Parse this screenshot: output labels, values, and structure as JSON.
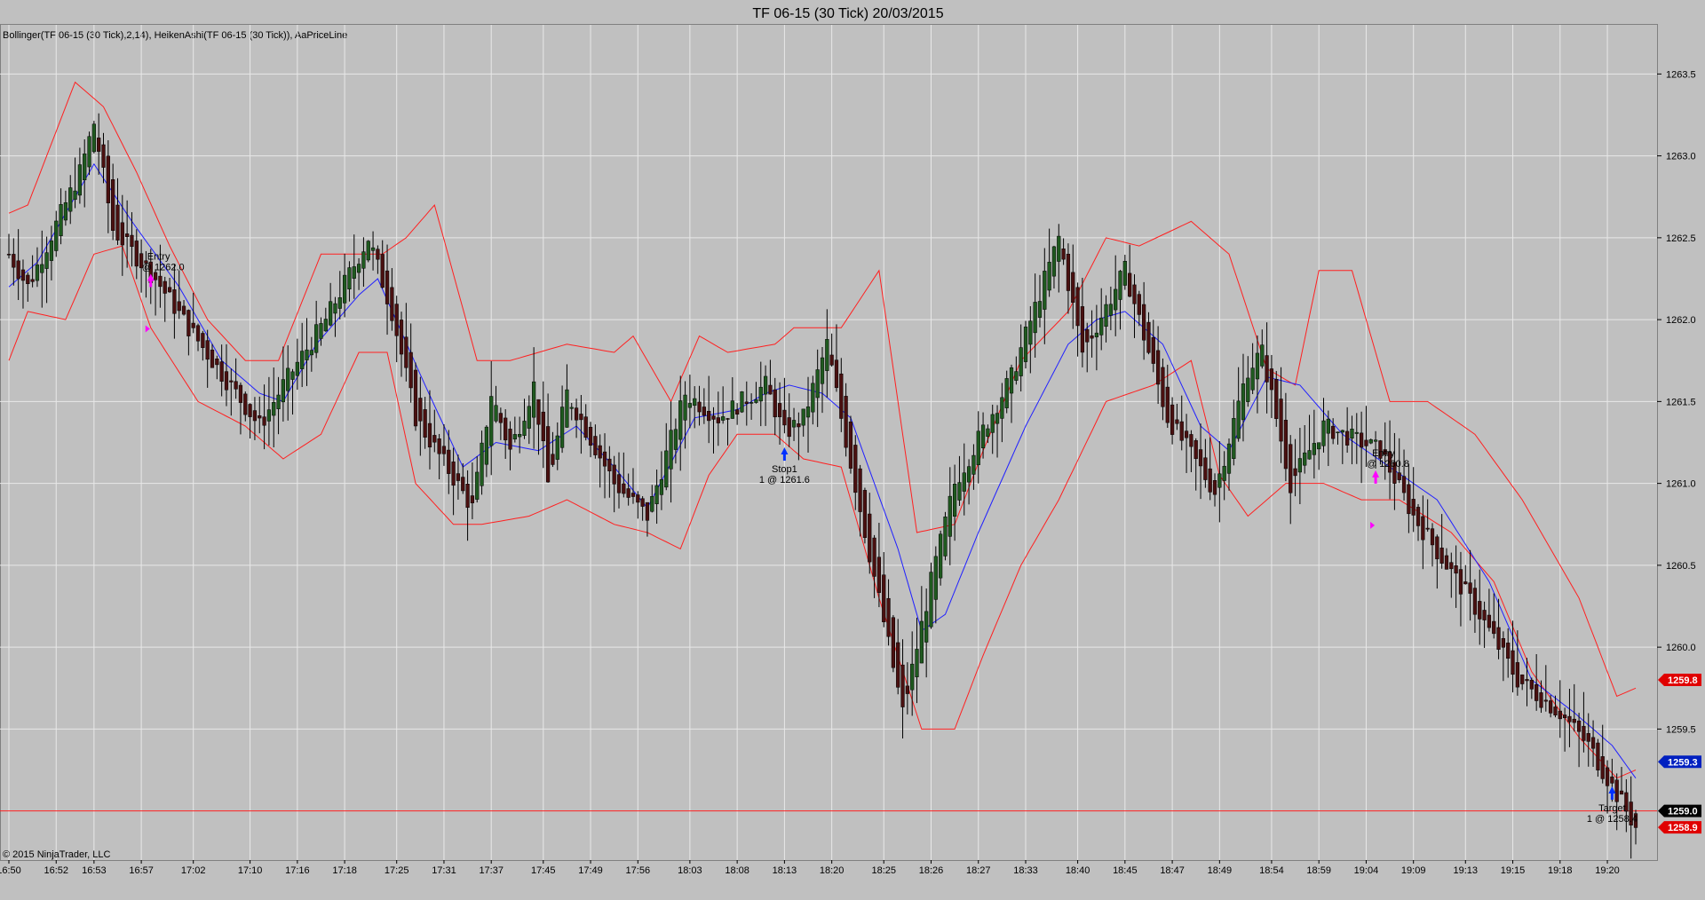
{
  "window": {
    "title": "TF 06-15 (30 Tick)  20/03/2015",
    "indicators": "Bollinger(TF 06-15 (30 Tick),2,14), HeikenAshi(TF 06-15 (30 Tick)), AaPriceLine",
    "copyright": "© 2015 NinjaTrader, LLC"
  },
  "colors": {
    "background": "#c0c0c0",
    "bullish_candle": "#1f5a1f",
    "bearish_candle": "#4a1010",
    "bollinger_bands": "#ff2020",
    "bollinger_mid": "#2020ff",
    "price_line": "#ff2020",
    "entry_marker": "#ff00ff",
    "exit_marker": "#0030ff"
  },
  "chart_data": {
    "type": "candlestick",
    "instrument": "TF 06-15",
    "period": "30 Tick",
    "date": "20/03/2015",
    "ylim": [
      1258.7,
      1263.8
    ],
    "y_ticks": [
      "1263.5",
      "1263.0",
      "1262.5",
      "1262.0",
      "1261.5",
      "1261.0",
      "1260.5",
      "1260.0",
      "1259.5"
    ],
    "x_ticks": [
      "16:50",
      "16:52",
      "16:53",
      "16:57",
      "17:02",
      "17:10",
      "17:16",
      "17:18",
      "17:25",
      "17:31",
      "17:37",
      "17:45",
      "17:49",
      "17:56",
      "18:03",
      "18:08",
      "18:13",
      "18:20",
      "18:25",
      "18:26",
      "18:27",
      "18:33",
      "18:40",
      "18:45",
      "18:47",
      "18:49",
      "18:54",
      "18:59",
      "19:04",
      "19:09",
      "19:13",
      "19:15",
      "19:18",
      "19:20"
    ],
    "x_tick_bars": [
      0,
      10,
      18,
      28,
      39,
      51,
      61,
      71,
      82,
      92,
      102,
      113,
      123,
      133,
      144,
      154,
      164,
      174,
      185,
      195,
      205,
      215,
      226,
      236,
      246,
      256,
      267,
      277,
      287,
      297,
      308,
      318,
      328,
      338
    ],
    "n_bars": 345,
    "grid": true,
    "series": [
      {
        "kind": "heiken_ashi_close",
        "anchors": [
          [
            0,
            1262.4
          ],
          [
            4,
            1262.2
          ],
          [
            15,
            1262.9
          ],
          [
            18,
            1263.2
          ],
          [
            22,
            1262.55
          ],
          [
            31,
            1262.25
          ],
          [
            38,
            1261.95
          ],
          [
            53,
            1261.35
          ],
          [
            58,
            1261.6
          ],
          [
            67,
            1262.0
          ],
          [
            76,
            1262.5
          ],
          [
            81,
            1262.05
          ],
          [
            86,
            1261.4
          ],
          [
            98,
            1260.85
          ],
          [
            102,
            1261.55
          ],
          [
            106,
            1261.2
          ],
          [
            111,
            1261.6
          ],
          [
            114,
            1261.0
          ],
          [
            118,
            1261.55
          ],
          [
            128,
            1261.0
          ],
          [
            135,
            1260.8
          ],
          [
            143,
            1261.55
          ],
          [
            150,
            1261.4
          ],
          [
            160,
            1261.6
          ],
          [
            164,
            1261.3
          ],
          [
            168,
            1261.4
          ],
          [
            173,
            1261.85
          ],
          [
            176,
            1261.4
          ],
          [
            189,
            1259.6
          ],
          [
            195,
            1260.4
          ],
          [
            200,
            1261.0
          ],
          [
            212,
            1261.65
          ],
          [
            222,
            1262.5
          ],
          [
            227,
            1261.8
          ],
          [
            236,
            1262.3
          ],
          [
            245,
            1261.4
          ],
          [
            255,
            1260.95
          ],
          [
            262,
            1261.7
          ],
          [
            265,
            1261.8
          ],
          [
            271,
            1261.0
          ],
          [
            278,
            1261.35
          ],
          [
            290,
            1261.2
          ],
          [
            297,
            1260.8
          ],
          [
            311,
            1260.2
          ],
          [
            319,
            1259.8
          ],
          [
            328,
            1259.6
          ],
          [
            334,
            1259.4
          ],
          [
            340,
            1259.1
          ],
          [
            344,
            1258.9
          ]
        ]
      },
      {
        "kind": "bollinger_mid",
        "anchors": [
          [
            0,
            1262.2
          ],
          [
            6,
            1262.35
          ],
          [
            18,
            1262.95
          ],
          [
            26,
            1262.6
          ],
          [
            36,
            1262.2
          ],
          [
            45,
            1261.75
          ],
          [
            53,
            1261.55
          ],
          [
            58,
            1261.5
          ],
          [
            65,
            1261.85
          ],
          [
            74,
            1262.15
          ],
          [
            78,
            1262.25
          ],
          [
            88,
            1261.6
          ],
          [
            96,
            1261.1
          ],
          [
            103,
            1261.25
          ],
          [
            112,
            1261.2
          ],
          [
            120,
            1261.35
          ],
          [
            128,
            1261.1
          ],
          [
            135,
            1260.85
          ],
          [
            145,
            1261.4
          ],
          [
            154,
            1261.45
          ],
          [
            160,
            1261.55
          ],
          [
            165,
            1261.6
          ],
          [
            172,
            1261.55
          ],
          [
            178,
            1261.4
          ],
          [
            188,
            1260.6
          ],
          [
            193,
            1260.1
          ],
          [
            198,
            1260.2
          ],
          [
            205,
            1260.7
          ],
          [
            215,
            1261.35
          ],
          [
            224,
            1261.85
          ],
          [
            230,
            1262.0
          ],
          [
            236,
            1262.05
          ],
          [
            244,
            1261.85
          ],
          [
            252,
            1261.35
          ],
          [
            258,
            1261.2
          ],
          [
            266,
            1261.65
          ],
          [
            273,
            1261.6
          ],
          [
            282,
            1261.3
          ],
          [
            292,
            1261.1
          ],
          [
            302,
            1260.9
          ],
          [
            313,
            1260.4
          ],
          [
            322,
            1259.8
          ],
          [
            331,
            1259.6
          ],
          [
            339,
            1259.4
          ],
          [
            344,
            1259.2
          ]
        ]
      },
      {
        "kind": "bollinger_upper",
        "anchors": [
          [
            0,
            1262.65
          ],
          [
            4,
            1262.7
          ],
          [
            14,
            1263.45
          ],
          [
            20,
            1263.3
          ],
          [
            27,
            1262.9
          ],
          [
            34,
            1262.45
          ],
          [
            42,
            1262.0
          ],
          [
            50,
            1261.75
          ],
          [
            57,
            1261.75
          ],
          [
            66,
            1262.4
          ],
          [
            74,
            1262.4
          ],
          [
            79,
            1262.4
          ],
          [
            84,
            1262.5
          ],
          [
            90,
            1262.7
          ],
          [
            99,
            1261.75
          ],
          [
            106,
            1261.75
          ],
          [
            112,
            1261.8
          ],
          [
            118,
            1261.85
          ],
          [
            128,
            1261.8
          ],
          [
            132,
            1261.9
          ],
          [
            140,
            1261.5
          ],
          [
            146,
            1261.9
          ],
          [
            152,
            1261.8
          ],
          [
            162,
            1261.85
          ],
          [
            166,
            1261.95
          ],
          [
            176,
            1261.95
          ],
          [
            184,
            1262.3
          ],
          [
            192,
            1260.7
          ],
          [
            200,
            1260.75
          ],
          [
            206,
            1261.2
          ],
          [
            214,
            1261.75
          ],
          [
            224,
            1262.05
          ],
          [
            232,
            1262.5
          ],
          [
            239,
            1262.45
          ],
          [
            250,
            1262.6
          ],
          [
            258,
            1262.4
          ],
          [
            266,
            1261.7
          ],
          [
            272,
            1261.6
          ],
          [
            277,
            1262.3
          ],
          [
            284,
            1262.3
          ],
          [
            292,
            1261.5
          ],
          [
            300,
            1261.5
          ],
          [
            310,
            1261.3
          ],
          [
            320,
            1260.9
          ],
          [
            332,
            1260.3
          ],
          [
            340,
            1259.7
          ],
          [
            344,
            1259.75
          ]
        ]
      },
      {
        "kind": "bollinger_lower",
        "anchors": [
          [
            0,
            1261.75
          ],
          [
            4,
            1262.05
          ],
          [
            12,
            1262.0
          ],
          [
            18,
            1262.4
          ],
          [
            24,
            1262.45
          ],
          [
            30,
            1261.95
          ],
          [
            40,
            1261.5
          ],
          [
            50,
            1261.35
          ],
          [
            58,
            1261.15
          ],
          [
            66,
            1261.3
          ],
          [
            74,
            1261.8
          ],
          [
            80,
            1261.8
          ],
          [
            86,
            1261.0
          ],
          [
            94,
            1260.75
          ],
          [
            100,
            1260.75
          ],
          [
            110,
            1260.8
          ],
          [
            118,
            1260.9
          ],
          [
            128,
            1260.75
          ],
          [
            135,
            1260.7
          ],
          [
            142,
            1260.6
          ],
          [
            148,
            1261.05
          ],
          [
            154,
            1261.3
          ],
          [
            162,
            1261.3
          ],
          [
            168,
            1261.15
          ],
          [
            176,
            1261.1
          ],
          [
            184,
            1260.3
          ],
          [
            193,
            1259.5
          ],
          [
            200,
            1259.5
          ],
          [
            206,
            1259.95
          ],
          [
            214,
            1260.5
          ],
          [
            222,
            1260.9
          ],
          [
            232,
            1261.5
          ],
          [
            242,
            1261.6
          ],
          [
            250,
            1261.75
          ],
          [
            256,
            1261.05
          ],
          [
            262,
            1260.8
          ],
          [
            270,
            1261.0
          ],
          [
            278,
            1261.0
          ],
          [
            286,
            1260.9
          ],
          [
            294,
            1260.9
          ],
          [
            305,
            1260.7
          ],
          [
            314,
            1260.4
          ],
          [
            322,
            1259.85
          ],
          [
            332,
            1259.45
          ],
          [
            340,
            1259.2
          ],
          [
            344,
            1259.25
          ]
        ]
      }
    ],
    "price_line": 1259.0,
    "price_tags": [
      {
        "label": "1259.8",
        "value": 1259.8,
        "color": "#e00000"
      },
      {
        "label": "1259.3",
        "value": 1259.3,
        "color": "#0020c0"
      },
      {
        "label": "1259.0",
        "value": 1259.0,
        "color": "#000000"
      },
      {
        "label": "1258.9",
        "value": 1258.9,
        "color": "#e00000"
      }
    ],
    "annotations": [
      {
        "line1": "Entry",
        "line2": "@ 1262.0",
        "bar": 30,
        "price": 1262.28,
        "marker": "entry"
      },
      {
        "line1": "Stop1",
        "line2": "1 @ 1261.6",
        "bar": 164,
        "price": 1261.22,
        "marker": "exit"
      },
      {
        "line1": "Entry",
        "line2": "@ 1260.8",
        "bar": 289,
        "price": 1261.08,
        "marker": "entry"
      },
      {
        "line1": "Target",
        "line2": "1 @ 1258.4",
        "bar": 339,
        "price": 1259.15,
        "marker": "exit"
      }
    ]
  }
}
